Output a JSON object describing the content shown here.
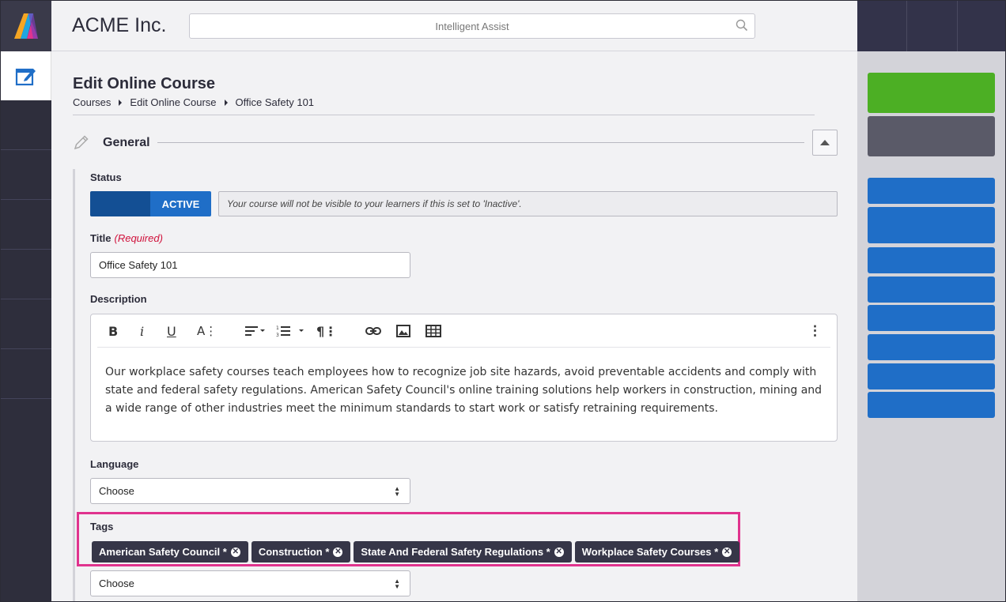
{
  "header": {
    "company": "ACME Inc.",
    "search_placeholder": "Intelligent Assist"
  },
  "page": {
    "title": "Edit Online Course",
    "breadcrumbs": [
      "Courses",
      "Edit Online Course",
      "Office Safety 101"
    ]
  },
  "section": {
    "title": "General"
  },
  "status": {
    "label": "Status",
    "toggle_text": "ACTIVE",
    "hint": "Your course will not be visible to your learners if this is set to 'Inactive'."
  },
  "title_field": {
    "label": "Title",
    "required": "(Required)",
    "value": "Office Safety 101"
  },
  "description": {
    "label": "Description",
    "text": "Our workplace safety courses teach employees how to recognize job site hazards, avoid preventable accidents and comply with state and federal safety regulations. American Safety Council's online training solutions help workers in construction, mining and a wide range of other industries meet the minimum standards to start work or satisfy retraining requirements."
  },
  "language": {
    "label": "Language",
    "value": "Choose"
  },
  "tags": {
    "label": "Tags",
    "items": [
      "American Safety Council *",
      "Construction *",
      "State And Federal Safety Regulations *",
      "Workplace Safety Courses *"
    ],
    "select_value": "Choose"
  },
  "colors": {
    "nav_dark": "#2e2e3c",
    "primary_blue": "#1f6ec7",
    "success_green": "#4caf24",
    "muted_gray": "#5a5a68",
    "highlight_pink": "#e0338e",
    "required_red": "#d0103a"
  },
  "icons": {
    "logo": "acme-logo",
    "nav": "edit-course-icon",
    "search": "search-icon",
    "section": "pencil-icon",
    "collapse": "chevron-up-icon"
  }
}
